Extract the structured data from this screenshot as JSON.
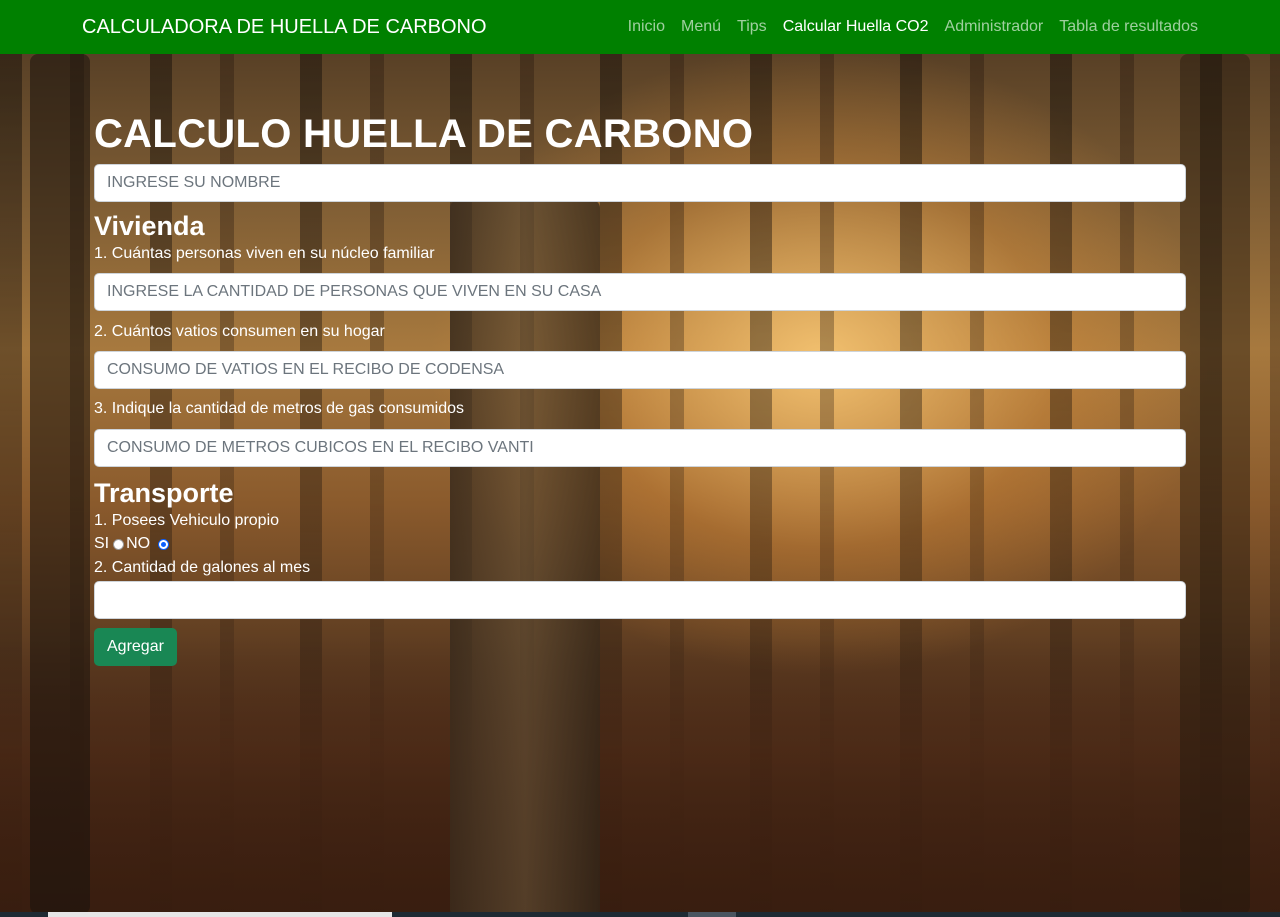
{
  "navbar": {
    "brand": "CALCULADORA DE HUELLA DE CARBONO",
    "links": [
      {
        "label": "Inicio",
        "active": false
      },
      {
        "label": "Menú",
        "active": false
      },
      {
        "label": "Tips",
        "active": false
      },
      {
        "label": "Calcular Huella CO2",
        "active": true
      },
      {
        "label": "Administrador",
        "active": false
      },
      {
        "label": "Tabla de resultados",
        "active": false
      }
    ],
    "color": "#008000"
  },
  "form": {
    "title": "CALCULO HUELLA DE CARBONO",
    "name_placeholder": "INGRESE SU NOMBRE",
    "vivienda": {
      "heading": "Vivienda",
      "q1": "1. Cuántas personas viven en su núcleo familiar",
      "q1_placeholder": "INGRESE LA CANTIDAD DE PERSONAS QUE VIVEN EN SU CASA",
      "q2": "2. Cuántos vatios consumen en su hogar",
      "q2_placeholder": "CONSUMO DE VATIOS EN EL RECIBO DE CODENSA",
      "q3": "3. Indique la cantidad de metros de gas consumidos",
      "q3_placeholder": "CONSUMO DE METROS CUBICOS EN EL RECIBO VANTI"
    },
    "transporte": {
      "heading": "Transporte",
      "q1": "1. Posees Vehiculo propio",
      "option_si": "SI",
      "option_no": "NO",
      "selected": "NO",
      "q2": "2. Cantidad de galones al mes",
      "q2_value": ""
    },
    "submit_label": "Agregar",
    "submit_color": "#198754"
  }
}
